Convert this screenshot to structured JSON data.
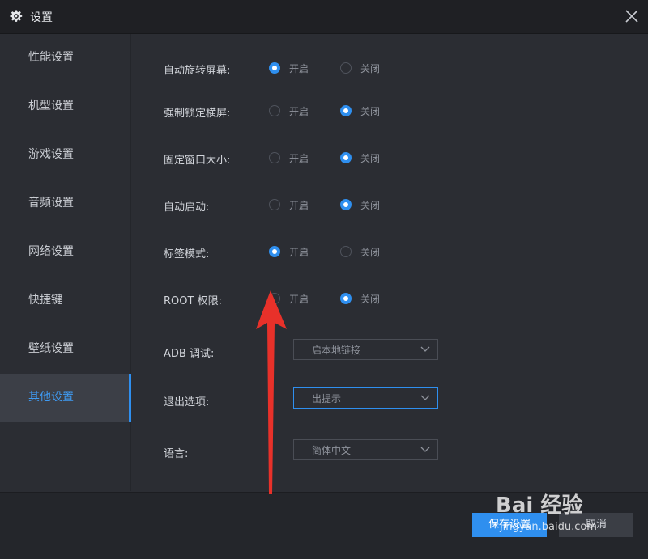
{
  "window": {
    "title": "设置"
  },
  "sidebar": {
    "items": [
      {
        "label": "性能设置"
      },
      {
        "label": "机型设置"
      },
      {
        "label": "游戏设置"
      },
      {
        "label": "音频设置"
      },
      {
        "label": "网络设置"
      },
      {
        "label": "快捷键"
      },
      {
        "label": "壁纸设置"
      },
      {
        "label": "其他设置",
        "active": true
      }
    ]
  },
  "settings": {
    "rows": [
      {
        "label": "自动旋转屏幕:",
        "on": "开启",
        "off": "关闭",
        "selected": "开启"
      },
      {
        "label": "强制锁定横屏:",
        "on": "开启",
        "off": "关闭",
        "selected": "关闭"
      },
      {
        "label": "固定窗口大小:",
        "on": "开启",
        "off": "关闭",
        "selected": "关闭"
      },
      {
        "label": "自动启动:",
        "on": "开启",
        "off": "关闭",
        "selected": "关闭"
      },
      {
        "label": "标签模式:",
        "on": "开启",
        "off": "关闭",
        "selected": "开启"
      },
      {
        "label": "ROOT 权限:",
        "on": "开启",
        "off": "关闭",
        "selected": "关闭"
      }
    ],
    "selects": [
      {
        "label": "ADB 调试:",
        "value": "启本地链接"
      },
      {
        "label": "退出选项:",
        "value": "出提示"
      },
      {
        "label": "语言:",
        "value": "简体中文"
      }
    ]
  },
  "footer": {
    "save_label": "保存设置",
    "cancel_label": "取消"
  },
  "watermark": {
    "logo": "Bai 经验",
    "url": "jingyan.baidu.com"
  },
  "colors": {
    "accent": "#2f8fef",
    "annotation_arrow": "#e8312a"
  },
  "icons": {
    "title": "gear-icon",
    "close": "close-icon",
    "select": "chevron-down-icon"
  }
}
